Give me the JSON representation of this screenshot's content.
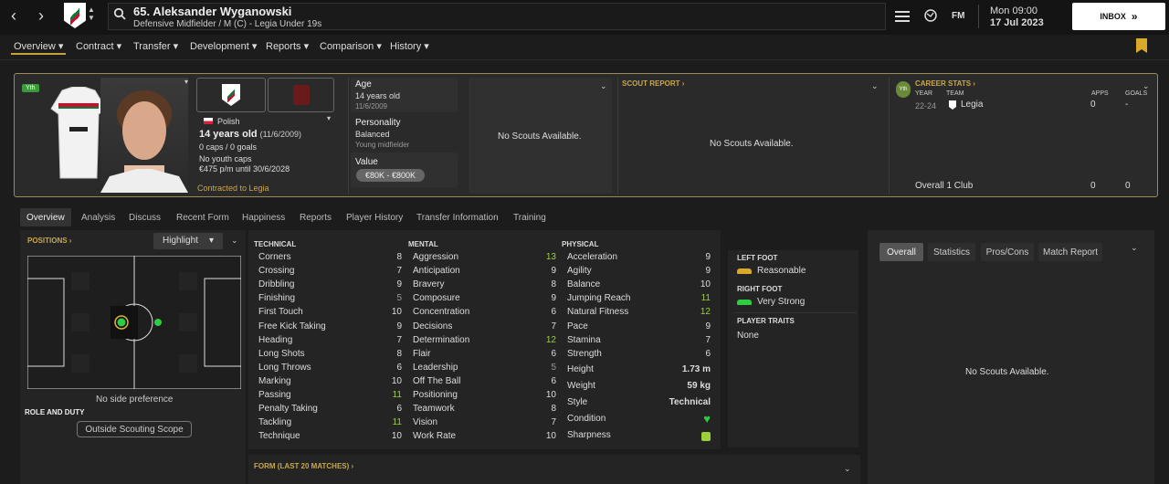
{
  "topbar": {
    "player_name": "65. Aleksander Wyganowski",
    "player_desc": "Defensive Midfielder / M (C) - Legia Under 19s",
    "date_line1": "Mon 09:00",
    "date_line2": "17 Jul 2023",
    "inbox_label": "INBOX",
    "fm_label": "FM"
  },
  "menu": [
    "Overview",
    "Contract",
    "Transfer",
    "Development",
    "Reports",
    "Comparison",
    "History"
  ],
  "header": {
    "badge_yth": "Yth",
    "nationality": "Polish",
    "age_line": "14 years old",
    "dob_paren": "(11/6/2009)",
    "caps": "0 caps / 0 goals",
    "youth_caps": "No youth caps",
    "wage": "€475 p/m until 30/6/2028",
    "contracted": "Contracted to Legia",
    "age_label": "Age",
    "age_value": "14 years old",
    "age_date": "11/6/2009",
    "personality_label": "Personality",
    "personality_value": "Balanced",
    "personality_sub": "Young midfielder",
    "value_label": "Value",
    "value_range": "€80K - €800K",
    "no_scouts": "No Scouts Available.",
    "scout_report_label": "SCOUT REPORT",
    "scout_report_text": "No Scouts Available.",
    "career_stats_label": "CAREER STATS",
    "career_cols": {
      "year": "YEAR",
      "team": "TEAM",
      "apps": "APPS",
      "goals": "GOALS"
    },
    "career_row": {
      "year": "22-24",
      "team": "Legia",
      "apps": "0",
      "goals": "-"
    },
    "career_total": {
      "label": "Overall 1 Club",
      "apps": "0",
      "goals": "0"
    }
  },
  "subtabs": [
    "Overview",
    "Analysis",
    "Discuss",
    "Recent Form",
    "Happiness",
    "Reports",
    "Player History",
    "Transfer Information",
    "Training"
  ],
  "positions": {
    "label": "POSITIONS",
    "highlight": "Highlight",
    "side_pref": "No side preference",
    "role_label": "ROLE AND DUTY",
    "scope_btn": "Outside Scouting Scope"
  },
  "technical": {
    "label": "TECHNICAL",
    "attrs": [
      [
        "Corners",
        "8"
      ],
      [
        "Crossing",
        "7"
      ],
      [
        "Dribbling",
        "9"
      ],
      [
        "Finishing",
        "5"
      ],
      [
        "First Touch",
        "10"
      ],
      [
        "Free Kick Taking",
        "9"
      ],
      [
        "Heading",
        "7"
      ],
      [
        "Long Shots",
        "8"
      ],
      [
        "Long Throws",
        "6"
      ],
      [
        "Marking",
        "10"
      ],
      [
        "Passing",
        "11"
      ],
      [
        "Penalty Taking",
        "6"
      ],
      [
        "Tackling",
        "11"
      ],
      [
        "Technique",
        "10"
      ]
    ]
  },
  "mental": {
    "label": "MENTAL",
    "attrs": [
      [
        "Aggression",
        "13"
      ],
      [
        "Anticipation",
        "9"
      ],
      [
        "Bravery",
        "8"
      ],
      [
        "Composure",
        "9"
      ],
      [
        "Concentration",
        "6"
      ],
      [
        "Decisions",
        "7"
      ],
      [
        "Determination",
        "12"
      ],
      [
        "Flair",
        "6"
      ],
      [
        "Leadership",
        "5"
      ],
      [
        "Off The Ball",
        "6"
      ],
      [
        "Positioning",
        "10"
      ],
      [
        "Teamwork",
        "8"
      ],
      [
        "Vision",
        "7"
      ],
      [
        "Work Rate",
        "10"
      ]
    ]
  },
  "physical": {
    "label": "PHYSICAL",
    "attrs": [
      [
        "Acceleration",
        "9"
      ],
      [
        "Agility",
        "9"
      ],
      [
        "Balance",
        "10"
      ],
      [
        "Jumping Reach",
        "11"
      ],
      [
        "Natural Fitness",
        "12"
      ],
      [
        "Pace",
        "9"
      ],
      [
        "Stamina",
        "7"
      ],
      [
        "Strength",
        "6"
      ]
    ],
    "info": [
      [
        "Height",
        "1.73 m"
      ],
      [
        "Weight",
        "59 kg"
      ],
      [
        "Style",
        "Technical"
      ]
    ],
    "condition": "Condition",
    "sharpness": "Sharpness"
  },
  "feet": {
    "left_label": "LEFT FOOT",
    "left_value": "Reasonable",
    "right_label": "RIGHT FOOT",
    "right_value": "Very Strong",
    "traits_label": "PLAYER TRAITS",
    "traits_value": "None"
  },
  "form_label": "FORM (LAST 20 MATCHES)",
  "right_panel": {
    "tabs": [
      "Overall",
      "Statistics",
      "Pros/Cons",
      "Match Report"
    ],
    "text": "No Scouts Available."
  },
  "colors": {
    "gold": "#c9a74a",
    "green_good": "#9ccf3a",
    "bg": "#1c1c1c"
  }
}
